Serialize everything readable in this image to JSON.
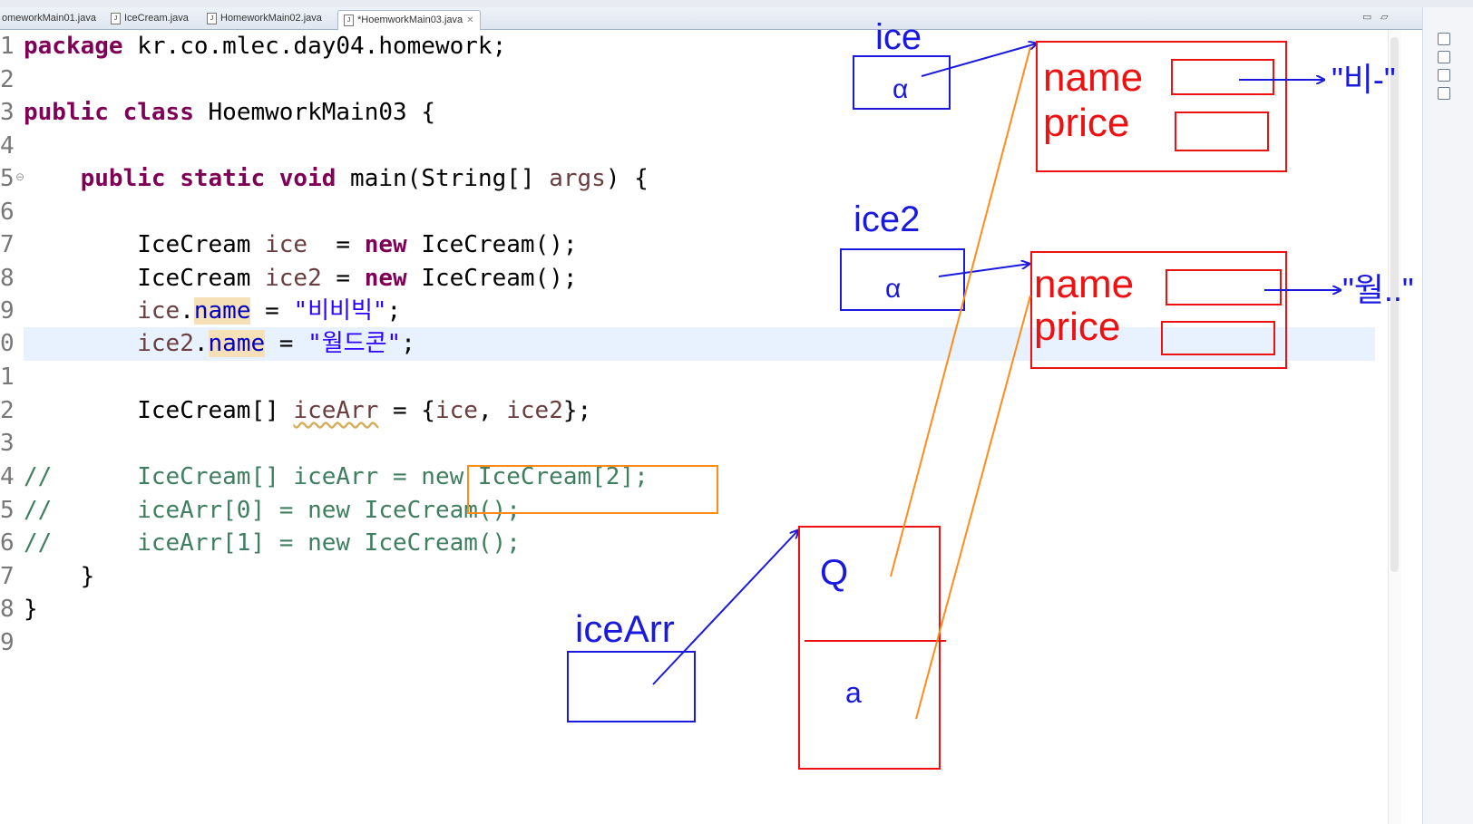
{
  "tabs": [
    {
      "label": "omeworkMain01.java",
      "active": false
    },
    {
      "label": "IceCream.java",
      "active": false
    },
    {
      "label": "HomeworkMain02.java",
      "active": false
    },
    {
      "label": "*HoemworkMain03.java",
      "active": true
    }
  ],
  "code": {
    "line_numbers": [
      "1",
      "2",
      "3",
      "4",
      "5",
      "6",
      "7",
      "8",
      "9",
      "0",
      "1",
      "2",
      "3",
      "4",
      "5",
      "6",
      "7",
      "8",
      "9"
    ],
    "l1": {
      "kw": "package",
      "rest": " kr.co.mlec.day04.homework;"
    },
    "l3": {
      "kw1": "public",
      "kw2": "class",
      "rest": " HoemworkMain03 {"
    },
    "l5": {
      "indent": "    ",
      "kw1": "public",
      "kw2": "static",
      "kw3": "void",
      "rest1": " main(String[] ",
      "param": "args",
      "rest2": ") {"
    },
    "l7": {
      "indent": "        ",
      "t1": "IceCream ",
      "v": "ice",
      "t2": "  = ",
      "kw": "new",
      "t3": " IceCream();"
    },
    "l8": {
      "indent": "        ",
      "t1": "IceCream ",
      "v": "ice2",
      "t2": " = ",
      "kw": "new",
      "t3": " IceCream();"
    },
    "l9": {
      "indent": "        ",
      "v": "ice",
      "dot": ".",
      "f": "name",
      "eq": " = ",
      "s": "\"비비빅\"",
      "end": ";"
    },
    "l10": {
      "indent": "        ",
      "v": "ice2",
      "dot": ".",
      "f": "name",
      "eq": " = ",
      "s": "\"월드콘\"",
      "end": ";"
    },
    "l12": {
      "indent": "        ",
      "t1": "IceCream[] ",
      "v": "iceArr",
      "t2": " = {",
      "a": "ice",
      "sep": ", ",
      "b": "ice2",
      "end": "};"
    },
    "l14": "//      IceCream[] iceArr = new IceCream[2];",
    "l15": "//      iceArr[0] = new IceCream();",
    "l16": "//      iceArr[1] = new IceCream();",
    "l17": "    }",
    "l18": "}"
  },
  "annotations": {
    "label_ice": "ice",
    "label_ice2": "ice2",
    "label_icearr": "iceArr",
    "field_name": "name",
    "field_price": "price",
    "ref_symbol": "α",
    "arr_slot0": "Q",
    "arr_slot1": "a",
    "value1": "\"비-\"",
    "value2": "\"월..\""
  },
  "colors": {
    "keyword": "#7f0055",
    "string": "#2a00ff",
    "field": "#0000c0",
    "comment": "#3f7f5f",
    "ink_blue": "#1a1adf",
    "ink_red": "#ee1111",
    "ink_orange": "#ff8c1a"
  }
}
